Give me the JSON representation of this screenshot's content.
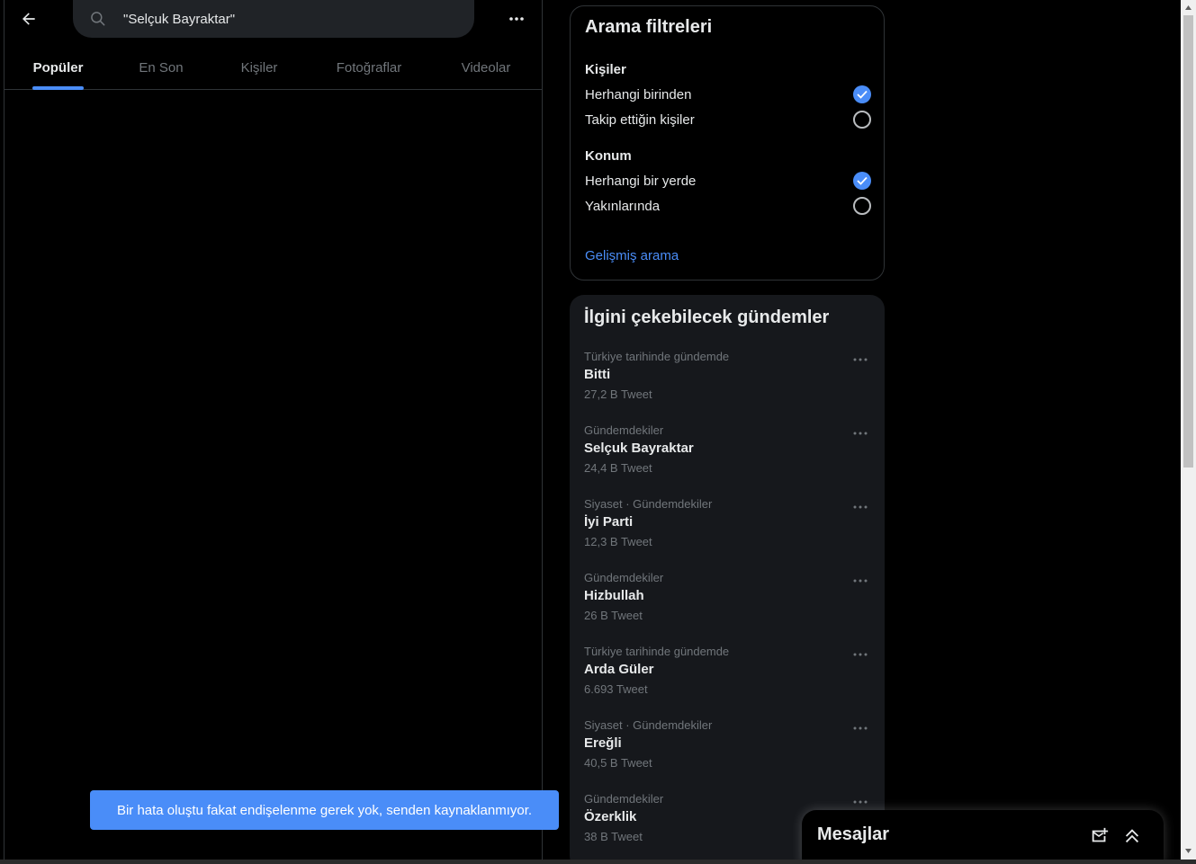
{
  "search": {
    "value": "\"Selçuk Bayraktar\""
  },
  "tabs": [
    {
      "label": "Popüler",
      "active": true
    },
    {
      "label": "En Son"
    },
    {
      "label": "Kişiler"
    },
    {
      "label": "Fotoğraflar"
    },
    {
      "label": "Videolar"
    }
  ],
  "error_toast": "Bir hata oluştu fakat endişelenme gerek yok, senden kaynaklanmıyor.",
  "filters": {
    "title": "Arama filtreleri",
    "people": {
      "heading": "Kişiler",
      "options": [
        {
          "label": "Herhangi birinden",
          "selected": true
        },
        {
          "label": "Takip ettiğin kişiler",
          "selected": false
        }
      ]
    },
    "location": {
      "heading": "Konum",
      "options": [
        {
          "label": "Herhangi bir yerde",
          "selected": true
        },
        {
          "label": "Yakınlarında",
          "selected": false
        }
      ]
    },
    "advanced_link": "Gelişmiş arama"
  },
  "trends": {
    "title": "İlgini çekebilecek gündemler",
    "items": [
      {
        "context": "Türkiye tarihinde gündemde",
        "name": "Bitti",
        "count": "27,2 B Tweet"
      },
      {
        "context": "Gündemdekiler",
        "name": "Selçuk Bayraktar",
        "count": "24,4 B Tweet"
      },
      {
        "context": "Siyaset · Gündemdekiler",
        "name": "İyi Parti",
        "count": "12,3 B Tweet"
      },
      {
        "context": "Gündemdekiler",
        "name": "Hizbullah",
        "count": "26 B Tweet"
      },
      {
        "context": "Türkiye tarihinde gündemde",
        "name": "Arda Güler",
        "count": "6.693 Tweet"
      },
      {
        "context": "Siyaset · Gündemdekiler",
        "name": "Ereğli",
        "count": "40,5 B Tweet"
      },
      {
        "context": "Gündemdekiler",
        "name": "Özerklik",
        "count": "38 B Tweet"
      }
    ]
  },
  "messages": {
    "title": "Mesajlar"
  },
  "colors": {
    "accent": "#4a8df8",
    "background": "#000000",
    "panel": "#16181c",
    "muted": "#71767b"
  }
}
